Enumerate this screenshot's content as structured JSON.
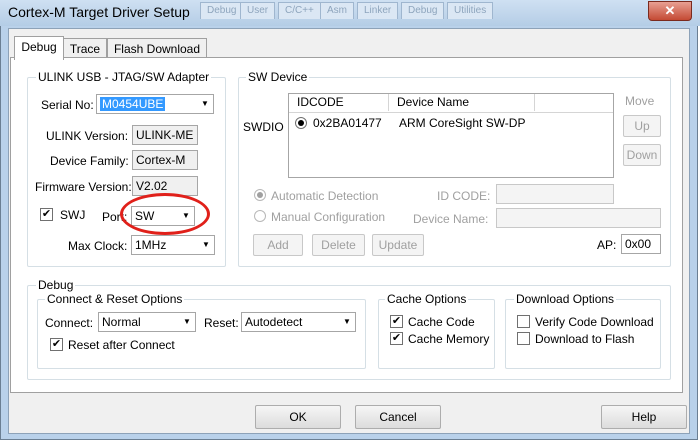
{
  "window": {
    "title": "Cortex-M Target Driver Setup",
    "close_label": "✕",
    "background_tabs": [
      "Debug",
      "User",
      "C/C++",
      "Asm",
      "Linker",
      "Debug",
      "Utilities"
    ]
  },
  "tabs": [
    "Debug",
    "Trace",
    "Flash Download"
  ],
  "ulink": {
    "legend": "ULINK USB - JTAG/SW Adapter",
    "serial_label": "Serial No:",
    "serial_value": "M0454UBE",
    "version_label": "ULINK Version:",
    "version_value": "ULINK-ME",
    "family_label": "Device Family:",
    "family_value": "Cortex-M",
    "firmware_label": "Firmware Version:",
    "firmware_value": "V2.02",
    "swj_label": "SWJ",
    "swj_checked": true,
    "port_label": "Port:",
    "port_value": "SW",
    "clock_label": "Max Clock:",
    "clock_value": "1MHz"
  },
  "sw_device": {
    "legend": "SW Device",
    "swdio_label": "SWDIO",
    "columns": [
      "IDCODE",
      "Device Name"
    ],
    "rows": [
      {
        "idcode": "0x2BA01477",
        "name": "ARM CoreSight SW-DP"
      }
    ],
    "move_label": "Move",
    "up_label": "Up",
    "down_label": "Down",
    "auto_label": "Automatic Detection",
    "manual_label": "Manual Configuration",
    "idcode_label": "ID CODE:",
    "devname_label": "Device Name:",
    "add_label": "Add",
    "delete_label": "Delete",
    "update_label": "Update",
    "ap_label": "AP:",
    "ap_value": "0x00"
  },
  "debug": {
    "legend": "Debug",
    "connect_group": "Connect & Reset Options",
    "connect_label": "Connect:",
    "connect_value": "Normal",
    "reset_label": "Reset:",
    "reset_value": "Autodetect",
    "reset_after_label": "Reset after Connect",
    "cache_group": "Cache Options",
    "cache_code_label": "Cache Code",
    "cache_memory_label": "Cache Memory",
    "download_group": "Download Options",
    "verify_label": "Verify Code Download",
    "download_flash_label": "Download to Flash"
  },
  "footer": {
    "ok_label": "OK",
    "cancel_label": "Cancel",
    "help_label": "Help"
  },
  "annotation": {
    "color": "#e0201a"
  }
}
